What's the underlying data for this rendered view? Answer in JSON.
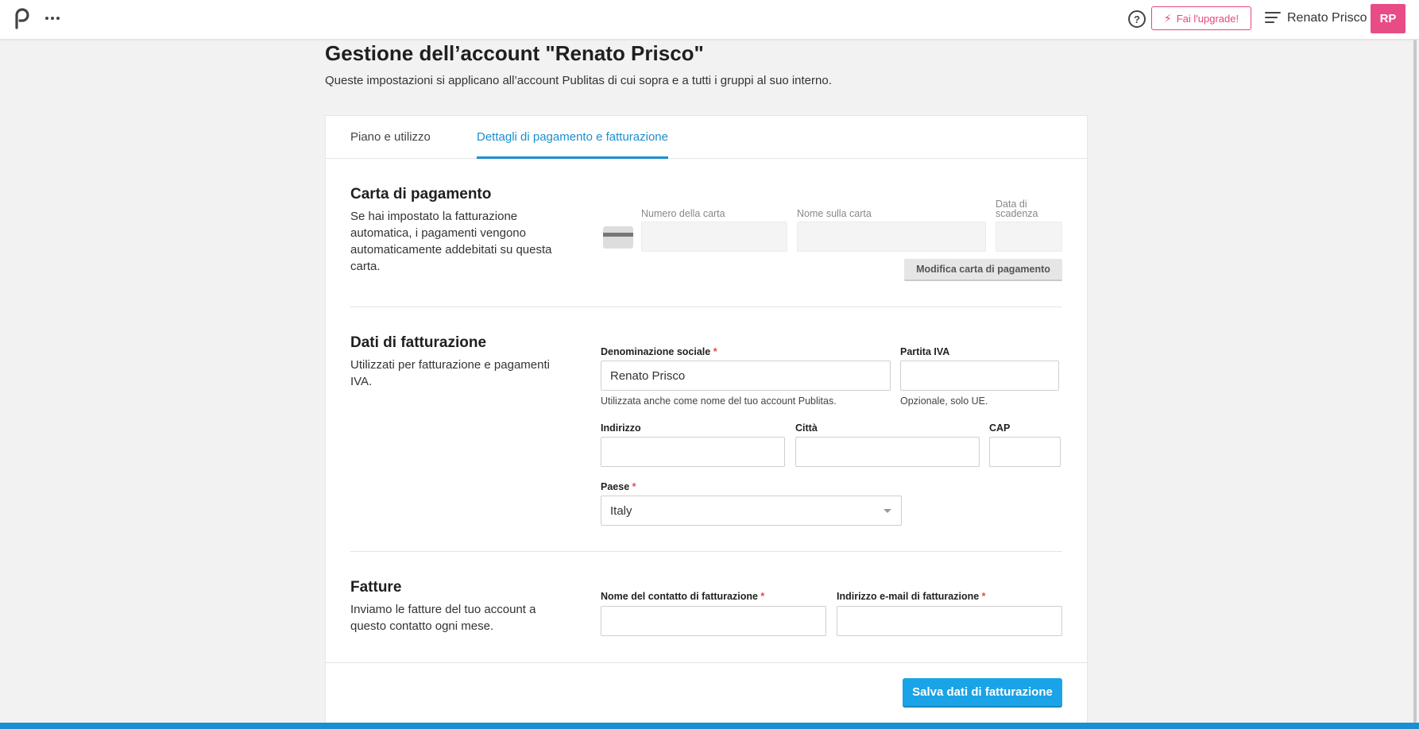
{
  "header": {
    "user_name": "Renato Prisco",
    "avatar_initials": "RP",
    "upgrade_label": "Fai l'upgrade!",
    "help_symbol": "?",
    "brand_color": "#e84c86",
    "accent_color": "#1b8fd1"
  },
  "page": {
    "title": "Gestione dell’account \"Renato Prisco\"",
    "subtitle": "Queste impostazioni si applicano all’account Publitas di cui sopra e a tutti i gruppi al suo interno."
  },
  "tabs": [
    {
      "label": "Piano e utilizzo",
      "active": false
    },
    {
      "label": "Dettagli di pagamento e fatturazione",
      "active": true
    }
  ],
  "payment_card": {
    "title": "Carta di pagamento",
    "description": "Se hai impostato la fatturazione automatica, i pagamenti vengono automaticamente addebitati su questa carta.",
    "card_number_label": "Numero della carta",
    "card_name_label": "Nome sulla carta",
    "expiry_label": "Data di scadenza",
    "modify_button": "Modifica carta di pagamento"
  },
  "billing": {
    "title": "Dati di fatturazione",
    "description": "Utilizzati per fatturazione e pagamenti IVA.",
    "company_label": "Denominazione sociale",
    "company_value": "Renato Prisco",
    "company_hint": "Utilizzata anche come nome del tuo account Publitas.",
    "vat_label": "Partita IVA",
    "vat_hint": "Opzionale, solo UE.",
    "address_label": "Indirizzo",
    "city_label": "Città",
    "zip_label": "CAP",
    "country_label": "Paese",
    "country_value": "Italy",
    "required_mark": "*"
  },
  "invoices": {
    "title": "Fatture",
    "description": "Inviamo le fatture del tuo account a questo contatto ogni mese.",
    "contact_name_label": "Nome del contatto di fatturazione",
    "contact_email_label": "Indirizzo e-mail di fatturazione"
  },
  "actions": {
    "save_button": "Salva dati di fatturazione"
  }
}
